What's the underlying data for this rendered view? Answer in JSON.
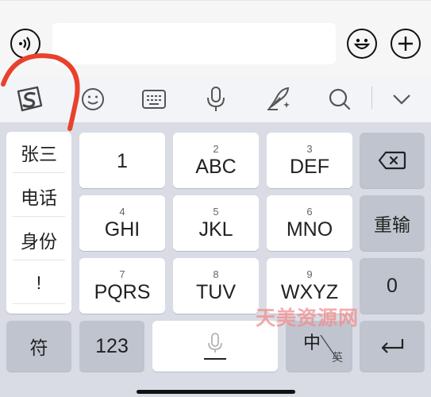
{
  "chat": {
    "input_value": "",
    "input_placeholder": ""
  },
  "toolbar": {
    "icons": [
      "sogou-logo-icon",
      "smiley-icon",
      "keyboard-icon",
      "microphone-icon",
      "quill-pen-icon",
      "search-icon",
      "chevron-down-icon"
    ]
  },
  "candidates": [
    "张三",
    "电话",
    "身份",
    "!"
  ],
  "keys": {
    "row1": [
      {
        "small": "",
        "main": "1"
      },
      {
        "small": "2",
        "main": "ABC"
      },
      {
        "small": "3",
        "main": "DEF"
      }
    ],
    "row2": [
      {
        "small": "4",
        "main": "GHI"
      },
      {
        "small": "5",
        "main": "JKL"
      },
      {
        "small": "6",
        "main": "MNO"
      }
    ],
    "row3": [
      {
        "small": "7",
        "main": "PQRS"
      },
      {
        "small": "8",
        "main": "TUV"
      },
      {
        "small": "9",
        "main": "WXYZ"
      }
    ],
    "reenter": "重输",
    "zero": "0",
    "symbol": "符",
    "numbers": "123",
    "lang_main": "中",
    "lang_alt": "英"
  },
  "watermark": "天美资源网",
  "colors": {
    "annotation": "#e8412c",
    "keyboard_bg": "#d9dce4",
    "dark_key": "#bfc4cf",
    "watermark": "#f28d8d"
  }
}
